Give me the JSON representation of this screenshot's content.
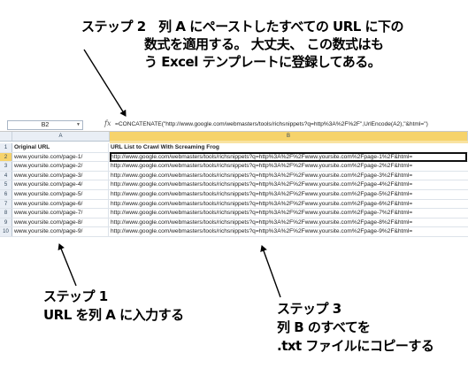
{
  "callouts": {
    "step2": {
      "line1": "ステップ 2　列 A にペーストしたすべての URL に下の",
      "line2": "数式を適用する。 大丈夫、 この数式はも",
      "line3": "う Excel テンプレートに登録してある。"
    },
    "step1": {
      "line1": "ステップ 1",
      "line2": "URL を列 A に入力する"
    },
    "step3": {
      "line1": "ステップ 3",
      "line2": "列 B のすべてを",
      "line3": ".txt ファイルにコピーする"
    }
  },
  "spreadsheet": {
    "name_box": "B2",
    "fx_symbol": "fx",
    "formula": "=CONCATENATE(\"http://www.google.com/webmasters/tools/richsnippets?q=http%3A%2F%2F\",UrlEncode(A2),\"&html=\")",
    "columns": [
      "A",
      "B"
    ],
    "rows": [
      {
        "num": "1",
        "a": "Original URL",
        "b": "URL List to Crawl With Screaming Frog"
      },
      {
        "num": "2",
        "a": "www.yoursite.com/page-1/",
        "b": "http://www.google.com/webmasters/tools/richsnippets?q=http%3A%2F%2Fwww.yoursite.com%2Fpage-1%2F&html="
      },
      {
        "num": "3",
        "a": "www.yoursite.com/page-2/",
        "b": "http://www.google.com/webmasters/tools/richsnippets?q=http%3A%2F%2Fwww.yoursite.com%2Fpage-2%2F&html="
      },
      {
        "num": "4",
        "a": "www.yoursite.com/page-3/",
        "b": "http://www.google.com/webmasters/tools/richsnippets?q=http%3A%2F%2Fwww.yoursite.com%2Fpage-3%2F&html="
      },
      {
        "num": "5",
        "a": "www.yoursite.com/page-4/",
        "b": "http://www.google.com/webmasters/tools/richsnippets?q=http%3A%2F%2Fwww.yoursite.com%2Fpage-4%2F&html="
      },
      {
        "num": "6",
        "a": "www.yoursite.com/page-5/",
        "b": "http://www.google.com/webmasters/tools/richsnippets?q=http%3A%2F%2Fwww.yoursite.com%2Fpage-5%2F&html="
      },
      {
        "num": "7",
        "a": "www.yoursite.com/page-6/",
        "b": "http://www.google.com/webmasters/tools/richsnippets?q=http%3A%2F%2Fwww.yoursite.com%2Fpage-6%2F&html="
      },
      {
        "num": "8",
        "a": "www.yoursite.com/page-7/",
        "b": "http://www.google.com/webmasters/tools/richsnippets?q=http%3A%2F%2Fwww.yoursite.com%2Fpage-7%2F&html="
      },
      {
        "num": "9",
        "a": "www.yoursite.com/page-8/",
        "b": "http://www.google.com/webmasters/tools/richsnippets?q=http%3A%2F%2Fwww.yoursite.com%2Fpage-8%2F&html="
      },
      {
        "num": "10",
        "a": "www.yoursite.com/page-9/",
        "b": "http://www.google.com/webmasters/tools/richsnippets?q=http%3A%2F%2Fwww.yoursite.com%2Fpage-9%2F&html="
      }
    ],
    "colors": {
      "highlight": "#f6d36b",
      "header_bg": "#e9eef5"
    }
  }
}
